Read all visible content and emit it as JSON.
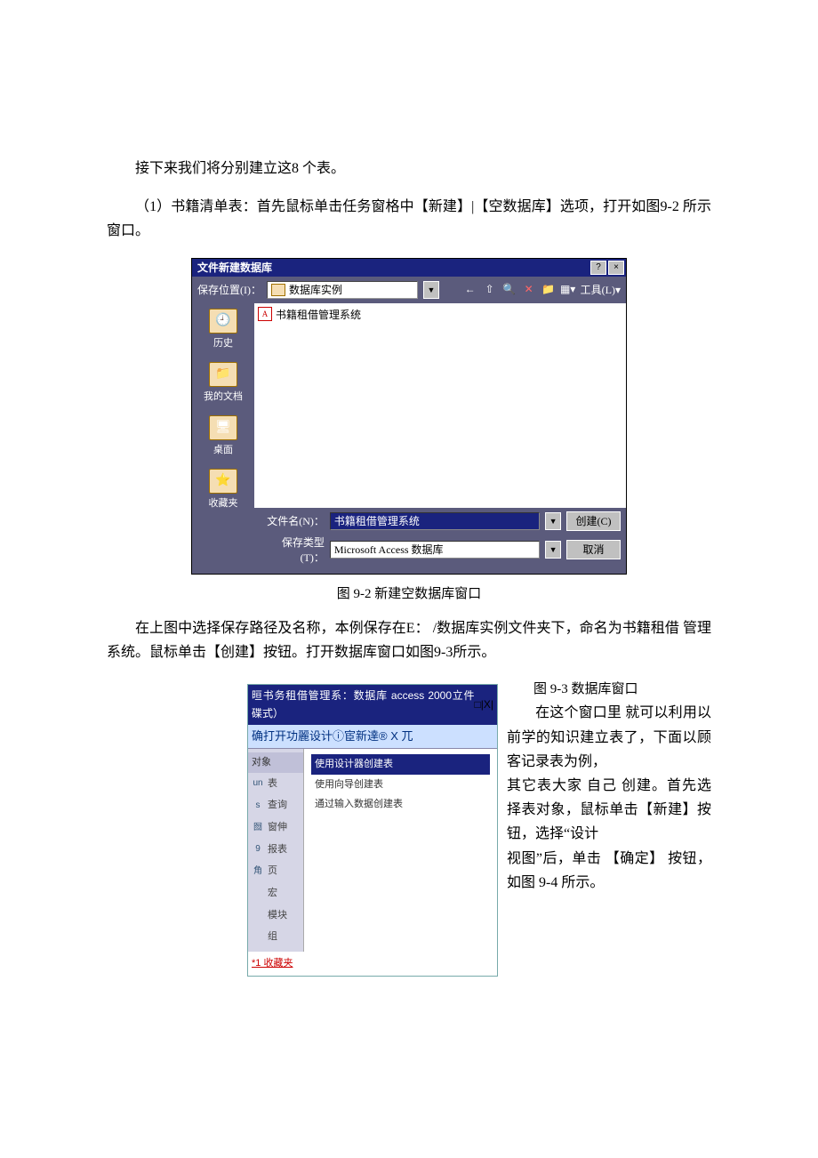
{
  "text": {
    "para1": "接下来我们将分别建立这8 个表。",
    "para2": "（1）书籍清单表：首先鼠标单击任务窗格中【新建】|【空数据库】选项，打开如图9-2 所示窗口。",
    "caption92": "图 9-2 新建空数据库窗口",
    "para3": "在上图中选择保存路径及名称，本例保存在E： /数据库实例文件夹下，命名为书籍租借 管理系统。鼠标单击【创建】按钮。打开数据库窗口如图9-3所示。",
    "caption93": "图 9-3 数据库窗口",
    "para4a": "在这个窗口里",
    "para4b": "就可以利用以前学的知识建立表了，下面以顾客记录表为例，",
    "para5a": "其它表大家 自己",
    "para5b": "创建。首先选择表对象，鼠标单击【新建】按钮，选择“设计",
    "para6a": "视图”后，单击",
    "para6b": "【确定】 按钮，如图 9-4 所示。"
  },
  "dialog1": {
    "title": "文件新建数据库",
    "help": "?",
    "close": "×",
    "saveLocLabel": "保存位置(I)：",
    "location": "数据库实例",
    "toolsLabel": "工具(L)",
    "places": [
      {
        "label": "历史",
        "icon": "🕘"
      },
      {
        "label": "我的文档",
        "icon": "📁"
      },
      {
        "label": "桌面",
        "icon": "🖥"
      },
      {
        "label": "收藏夹",
        "icon": "⭐"
      }
    ],
    "fileItem": "书籍租借管理系统",
    "filenameLabel": "文件名(N)：",
    "filenameValue": "书籍租借管理系统",
    "filetypeLabel": "保存类型(T)：",
    "filetypeValue": "Microsoft Access 数据库",
    "createBtn": "创建(C)",
    "cancelBtn": "取消"
  },
  "dbwin": {
    "title": "晅书务租借管理系：数据库  access 2000立件碟式）",
    "ctrls": "□|X|",
    "toolbar": "确打开功麗设计ⓘ宦新達® X 兀",
    "sideHeader": "对象",
    "sideItems": [
      {
        "icon": "un",
        "label": "表"
      },
      {
        "icon": "s",
        "label": "查询"
      },
      {
        "icon": "囫",
        "label": "窗伸"
      },
      {
        "icon": "9",
        "label": "报表"
      },
      {
        "icon": "角",
        "label": "页"
      },
      {
        "icon": "",
        "label": "宏"
      },
      {
        "icon": "",
        "label": "模块"
      },
      {
        "icon": "",
        "label": "组"
      }
    ],
    "options": [
      "使用设计器创建表",
      "使用向导创建表",
      "通过输入数据创建表"
    ],
    "fav": "*1 收藏夹"
  }
}
